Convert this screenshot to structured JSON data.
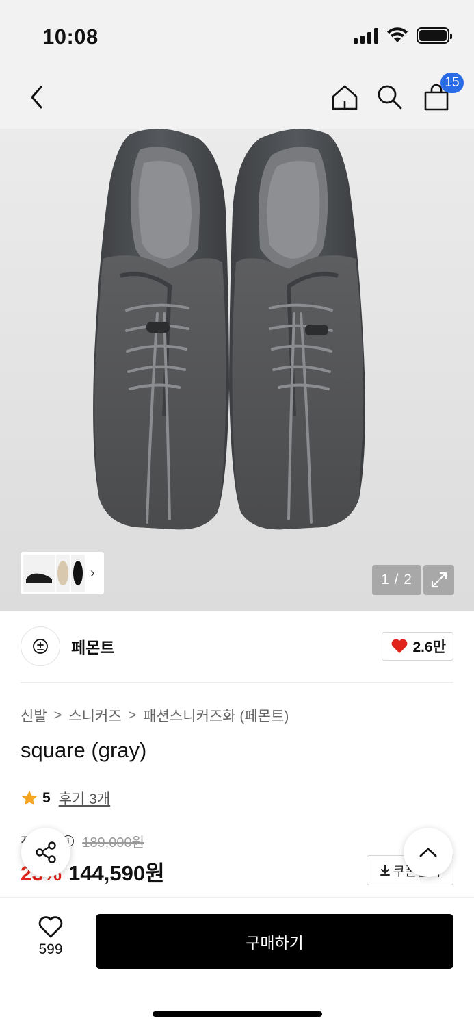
{
  "status_bar": {
    "time": "10:08"
  },
  "nav": {
    "back_icon": "chevron-left-icon",
    "home_icon": "home-icon",
    "search_icon": "search-icon",
    "bag_icon": "shopping-bag-icon",
    "bag_count": "15"
  },
  "gallery": {
    "counter": "1 / 2",
    "thumb_chevron": "›"
  },
  "brand": {
    "name": "페몬트",
    "like_count": "2.6만"
  },
  "breadcrumb": [
    "신발",
    "스니커즈",
    "패션스니커즈화 (페몬트)"
  ],
  "product": {
    "title": "square (gray)",
    "rating": "5",
    "reviews": "후기 3개",
    "price_label": "정상가",
    "original_price": "189,000원",
    "discount": "23%",
    "sale_price": "144,590원",
    "coupon_label": "쿠폰받기"
  },
  "bottom": {
    "wish_count": "599",
    "buy_label": "구매하기"
  },
  "colors": {
    "accent_red": "#e0241b",
    "badge_blue": "#2a6ce6",
    "buy_button": "#000000"
  }
}
